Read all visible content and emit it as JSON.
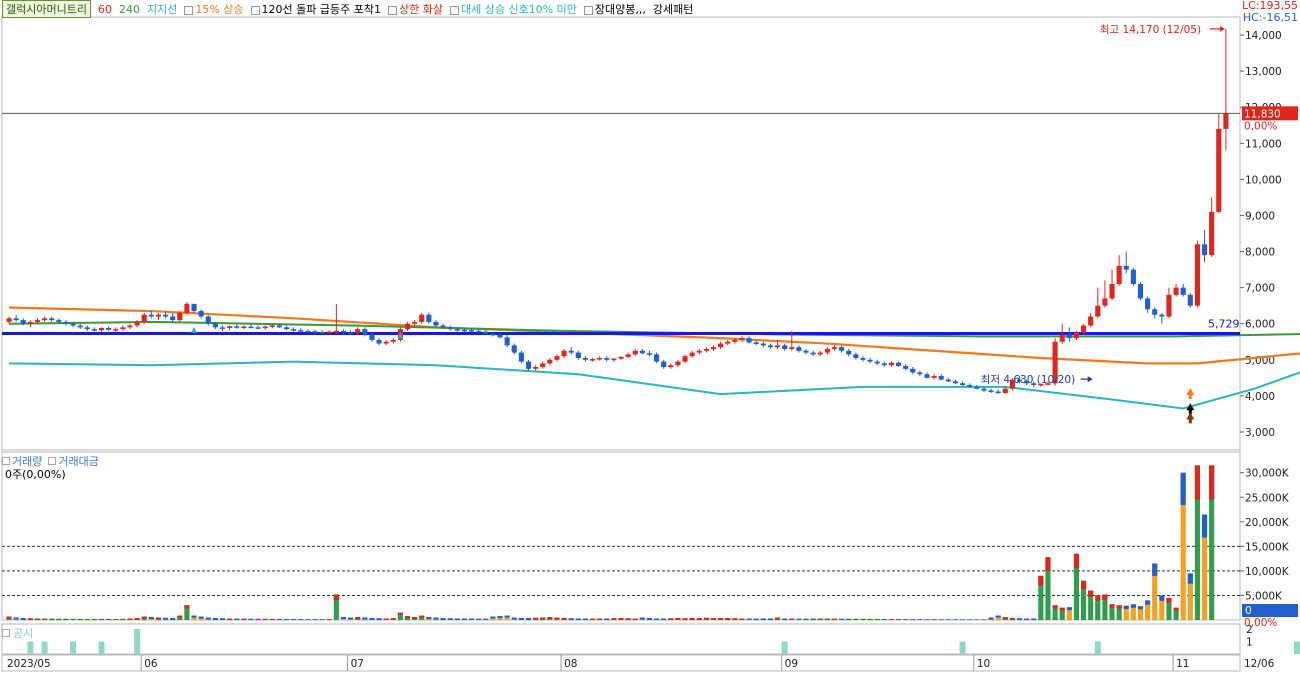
{
  "legend": {
    "title": "갤럭시아머니트리",
    "ma60": "60",
    "ma240": "240",
    "support": "지지선",
    "rise15": "15% 상승",
    "breakout": "120선 돌파 급등주 포착1",
    "limit_up": "상한 화살",
    "trend": "대세 상승 신호10% 미만",
    "long_candle": "장대양봉,,,",
    "strong": "강세패턴"
  },
  "top_right": {
    "lc": "LC:193,55",
    "hc": "HC:-16,51"
  },
  "annotations": {
    "high": "최고 14,170 (12/05)",
    "low": "최저 4,630 (10/20)",
    "level_label": "5,729"
  },
  "price_tags": {
    "current": "11,830",
    "pct": "0,00%"
  },
  "volume_legend": {
    "a": "거래량",
    "b": "거래대금",
    "sub": "0주(0,00%)"
  },
  "volume_tags": {
    "current": "0",
    "pct": "0,00%"
  },
  "disclosure_legend": "공시",
  "colors": {
    "up": "#e0251b",
    "down": "#1f5fd0",
    "ma_green": "#3a9a3a",
    "ma_orange": "#f07a20",
    "ma_teal": "#2bb5c0",
    "support": "#1a1acf",
    "vol_green": "#2e9e4c",
    "vol_orange": "#f5a020"
  },
  "chart_data": {
    "type": "candlestick",
    "price_axis": {
      "ticks": [
        3000,
        4000,
        5000,
        6000,
        7000,
        8000,
        9000,
        10000,
        11000,
        12000,
        13000,
        14000
      ],
      "tick_labels": [
        "3,000",
        "4,000",
        "5,000",
        "6,000",
        "7,000",
        "8,000",
        "9,000",
        "10,000",
        "11,000",
        "12,000",
        "13,000",
        "14,000"
      ],
      "range": [
        2500,
        14500
      ]
    },
    "volume_axis": {
      "ticks": [
        5000,
        10000,
        15000,
        20000,
        25000,
        30000
      ],
      "tick_labels": [
        "5,000K",
        "10,000K",
        "15,000K",
        "20,000K",
        "25,000K",
        "30,000K"
      ],
      "range": [
        0,
        33000
      ]
    },
    "disclosure_axis": {
      "ticks": [
        1,
        2
      ],
      "tick_labels": [
        "1",
        "2"
      ]
    },
    "x_labels": [
      {
        "label": "2023/05",
        "bar": 0
      },
      {
        "label": "06",
        "bar": 19
      },
      {
        "label": "07",
        "bar": 48
      },
      {
        "label": "08",
        "bar": 78
      },
      {
        "label": "09",
        "bar": 109
      },
      {
        "label": "10",
        "bar": 136
      },
      {
        "label": "11",
        "bar": 164
      },
      {
        "label": "12",
        "bar": 195
      },
      {
        "label": "12/06",
        "bar": 206
      }
    ],
    "support_level": 5729,
    "high": 14170,
    "low": 4630,
    "candles": [
      [
        6050,
        6200,
        6000,
        6150
      ],
      [
        6150,
        6250,
        6050,
        6100
      ],
      [
        6100,
        6150,
        5950,
        6000
      ],
      [
        6000,
        6100,
        5900,
        6050
      ],
      [
        6050,
        6150,
        5980,
        6100
      ],
      [
        6100,
        6200,
        6050,
        6150
      ],
      [
        6150,
        6200,
        6050,
        6100
      ],
      [
        6100,
        6150,
        6000,
        6050
      ],
      [
        6050,
        6100,
        5950,
        6000
      ],
      [
        6000,
        6050,
        5900,
        5950
      ],
      [
        5950,
        6000,
        5850,
        5900
      ],
      [
        5900,
        5950,
        5800,
        5850
      ],
      [
        5850,
        5900,
        5780,
        5820
      ],
      [
        5820,
        5900,
        5780,
        5880
      ],
      [
        5880,
        5920,
        5800,
        5830
      ],
      [
        5830,
        5900,
        5780,
        5850
      ],
      [
        5850,
        5950,
        5800,
        5900
      ],
      [
        5900,
        6000,
        5850,
        5950
      ],
      [
        5950,
        6100,
        5900,
        6050
      ],
      [
        6050,
        6300,
        6000,
        6250
      ],
      [
        6250,
        6350,
        6150,
        6200
      ],
      [
        6200,
        6300,
        6100,
        6250
      ],
      [
        6250,
        6350,
        6150,
        6200
      ],
      [
        6200,
        6300,
        6050,
        6100
      ],
      [
        6100,
        6350,
        6050,
        6300
      ],
      [
        6300,
        6600,
        6250,
        6550
      ],
      [
        6550,
        6550,
        6300,
        6350
      ],
      [
        6350,
        6400,
        6150,
        6200
      ],
      [
        6200,
        6250,
        5950,
        6000
      ],
      [
        6000,
        6050,
        5850,
        5900
      ],
      [
        5900,
        5950,
        5800,
        5880
      ],
      [
        5880,
        5950,
        5820,
        5930
      ],
      [
        5930,
        5980,
        5860,
        5900
      ],
      [
        5900,
        5950,
        5850,
        5920
      ],
      [
        5920,
        5980,
        5870,
        5900
      ],
      [
        5900,
        5950,
        5850,
        5880
      ],
      [
        5880,
        5950,
        5830,
        5920
      ],
      [
        5920,
        5980,
        5870,
        5950
      ],
      [
        5950,
        6000,
        5880,
        5900
      ],
      [
        5900,
        5950,
        5820,
        5850
      ],
      [
        5850,
        5900,
        5780,
        5820
      ],
      [
        5820,
        5870,
        5760,
        5800
      ],
      [
        5800,
        5850,
        5740,
        5790
      ],
      [
        5790,
        5840,
        5730,
        5770
      ],
      [
        5770,
        5830,
        5720,
        5760
      ],
      [
        5760,
        5820,
        5710,
        5780
      ],
      [
        5780,
        6550,
        5720,
        5800
      ],
      [
        5800,
        5850,
        5700,
        5760
      ],
      [
        5760,
        5820,
        5700,
        5750
      ],
      [
        5750,
        5900,
        5700,
        5850
      ],
      [
        5850,
        5900,
        5650,
        5700
      ],
      [
        5700,
        5750,
        5500,
        5550
      ],
      [
        5550,
        5600,
        5400,
        5450
      ],
      [
        5450,
        5550,
        5400,
        5500
      ],
      [
        5500,
        5600,
        5450,
        5550
      ],
      [
        5550,
        5900,
        5500,
        5850
      ],
      [
        5850,
        6050,
        5800,
        6000
      ],
      [
        6000,
        6100,
        5900,
        6050
      ],
      [
        6050,
        6300,
        6000,
        6250
      ],
      [
        6250,
        6300,
        6000,
        6050
      ],
      [
        6050,
        6100,
        5900,
        5950
      ],
      [
        5950,
        6000,
        5850,
        5900
      ],
      [
        5900,
        5950,
        5800,
        5850
      ],
      [
        5850,
        5900,
        5780,
        5830
      ],
      [
        5830,
        5880,
        5770,
        5820
      ],
      [
        5820,
        5870,
        5760,
        5800
      ],
      [
        5800,
        5850,
        5740,
        5780
      ],
      [
        5780,
        5820,
        5700,
        5720
      ],
      [
        5720,
        5780,
        5650,
        5700
      ],
      [
        5700,
        5750,
        5600,
        5620
      ],
      [
        5620,
        5680,
        5350,
        5400
      ],
      [
        5400,
        5450,
        5150,
        5200
      ],
      [
        5200,
        5250,
        4900,
        4950
      ],
      [
        4950,
        5000,
        4700,
        4750
      ],
      [
        4750,
        4850,
        4700,
        4800
      ],
      [
        4800,
        4950,
        4750,
        4900
      ],
      [
        4900,
        5050,
        4850,
        5000
      ],
      [
        5000,
        5150,
        4950,
        5100
      ],
      [
        5100,
        5300,
        5050,
        5250
      ],
      [
        5250,
        5350,
        5150,
        5200
      ],
      [
        5200,
        5250,
        5000,
        5050
      ],
      [
        5050,
        5100,
        4950,
        5000
      ],
      [
        5000,
        5050,
        4950,
        5020
      ],
      [
        5020,
        5100,
        4980,
        5050
      ],
      [
        5050,
        5100,
        4950,
        5000
      ],
      [
        5000,
        5050,
        4950,
        5030
      ],
      [
        5030,
        5100,
        5000,
        5080
      ],
      [
        5080,
        5200,
        5050,
        5150
      ],
      [
        5150,
        5300,
        5100,
        5250
      ],
      [
        5250,
        5300,
        5150,
        5180
      ],
      [
        5180,
        5250,
        5100,
        5150
      ],
      [
        5150,
        5200,
        4900,
        4950
      ],
      [
        4950,
        5000,
        4750,
        4800
      ],
      [
        4800,
        4900,
        4750,
        4850
      ],
      [
        4850,
        5000,
        4800,
        4950
      ],
      [
        4950,
        5150,
        4900,
        5100
      ],
      [
        5100,
        5250,
        5050,
        5200
      ],
      [
        5200,
        5300,
        5150,
        5250
      ],
      [
        5250,
        5350,
        5200,
        5300
      ],
      [
        5300,
        5400,
        5250,
        5350
      ],
      [
        5350,
        5500,
        5300,
        5450
      ],
      [
        5450,
        5550,
        5400,
        5500
      ],
      [
        5500,
        5600,
        5450,
        5550
      ],
      [
        5550,
        5650,
        5500,
        5600
      ],
      [
        5600,
        5650,
        5450,
        5480
      ],
      [
        5480,
        5550,
        5400,
        5450
      ],
      [
        5450,
        5500,
        5350,
        5400
      ],
      [
        5400,
        5450,
        5300,
        5350
      ],
      [
        5350,
        5550,
        5300,
        5400
      ],
      [
        5400,
        5450,
        5250,
        5300
      ],
      [
        5300,
        5800,
        5250,
        5350
      ],
      [
        5350,
        5400,
        5200,
        5250
      ],
      [
        5250,
        5300,
        5150,
        5200
      ],
      [
        5200,
        5250,
        5100,
        5150
      ],
      [
        5150,
        5250,
        5100,
        5200
      ],
      [
        5200,
        5350,
        5150,
        5300
      ],
      [
        5300,
        5400,
        5250,
        5350
      ],
      [
        5350,
        5400,
        5200,
        5250
      ],
      [
        5250,
        5300,
        5100,
        5150
      ],
      [
        5150,
        5200,
        5000,
        5050
      ],
      [
        5050,
        5100,
        4950,
        5000
      ],
      [
        5000,
        5050,
        4900,
        4950
      ],
      [
        4950,
        5000,
        4850,
        4900
      ],
      [
        4900,
        4950,
        4800,
        4850
      ],
      [
        4850,
        4950,
        4800,
        4920
      ],
      [
        4920,
        4950,
        4800,
        4830
      ],
      [
        4830,
        4880,
        4700,
        4750
      ],
      [
        4750,
        4800,
        4600,
        4650
      ],
      [
        4650,
        4700,
        4550,
        4600
      ],
      [
        4600,
        4650,
        4480,
        4500
      ],
      [
        4500,
        4600,
        4450,
        4550
      ],
      [
        4550,
        4600,
        4430,
        4450
      ],
      [
        4450,
        4500,
        4380,
        4400
      ],
      [
        4400,
        4450,
        4320,
        4350
      ],
      [
        4350,
        4400,
        4280,
        4300
      ],
      [
        4300,
        4350,
        4220,
        4250
      ],
      [
        4250,
        4300,
        4180,
        4200
      ],
      [
        4200,
        4250,
        4100,
        4150
      ],
      [
        4150,
        4200,
        4080,
        4120
      ],
      [
        4120,
        4180,
        4050,
        4080
      ],
      [
        4080,
        4250,
        4060,
        4200
      ],
      [
        4200,
        4500,
        4150,
        4450
      ],
      [
        4450,
        4550,
        4350,
        4400
      ],
      [
        4400,
        4450,
        4300,
        4350
      ],
      [
        4350,
        4400,
        4250,
        4300
      ],
      [
        4300,
        4350,
        4250,
        4330
      ],
      [
        4330,
        4400,
        4280,
        4350
      ],
      [
        4350,
        5600,
        4280,
        5500
      ],
      [
        5500,
        6000,
        5450,
        5700
      ],
      [
        5700,
        5900,
        5500,
        5600
      ],
      [
        5600,
        5800,
        5550,
        5750
      ],
      [
        5750,
        6000,
        5700,
        5950
      ],
      [
        5950,
        6300,
        5900,
        6200
      ],
      [
        6200,
        7000,
        6150,
        6500
      ],
      [
        6500,
        7200,
        6450,
        6700
      ],
      [
        6700,
        7500,
        6650,
        7100
      ],
      [
        7100,
        7900,
        7050,
        7600
      ],
      [
        7600,
        8000,
        7400,
        7500
      ],
      [
        7500,
        7550,
        7050,
        7100
      ],
      [
        7100,
        7150,
        6650,
        6700
      ],
      [
        6700,
        6750,
        6300,
        6400
      ],
      [
        6400,
        6450,
        6150,
        6250
      ],
      [
        6250,
        6300,
        6000,
        6200
      ],
      [
        6200,
        7000,
        6150,
        6800
      ],
      [
        6800,
        7100,
        6750,
        7000
      ],
      [
        7000,
        7100,
        6750,
        6800
      ],
      [
        6800,
        6850,
        6450,
        6500
      ],
      [
        6500,
        8300,
        6450,
        8200
      ],
      [
        8200,
        8600,
        7700,
        7900
      ],
      [
        7900,
        9500,
        7850,
        9100
      ],
      [
        9100,
        11800,
        9050,
        11400
      ],
      [
        11400,
        14170,
        10800,
        11830
      ]
    ],
    "volume_k": [
      700,
      500,
      400,
      350,
      300,
      280,
      260,
      240,
      230,
      220,
      210,
      200,
      200,
      220,
      210,
      200,
      230,
      300,
      400,
      700,
      600,
      500,
      450,
      400,
      900,
      3000,
      900,
      700,
      500,
      400,
      350,
      300,
      280,
      260,
      250,
      240,
      230,
      220,
      210,
      200,
      190,
      180,
      170,
      170,
      160,
      170,
      5200,
      600,
      500,
      600,
      500,
      400,
      350,
      300,
      350,
      1500,
      800,
      600,
      900,
      600,
      500,
      400,
      350,
      300,
      300,
      280,
      260,
      250,
      700,
      800,
      900,
      500,
      400,
      400,
      450,
      500,
      600,
      500,
      400,
      350,
      300,
      300,
      280,
      280,
      300,
      350,
      400,
      350,
      300,
      500,
      400,
      300,
      300,
      350,
      400,
      350,
      400,
      400,
      450,
      400,
      400,
      400,
      350,
      300,
      300,
      280,
      320,
      300,
      500,
      300,
      280,
      260,
      260,
      280,
      300,
      280,
      260,
      250,
      240,
      230,
      220,
      210,
      210,
      200,
      200,
      180,
      170,
      170,
      160,
      160,
      150,
      150,
      140,
      140,
      130,
      130,
      130,
      130,
      500,
      900,
      600,
      400,
      350,
      300,
      300,
      9000,
      12800,
      3000,
      2500,
      2600,
      13500,
      8000,
      6000,
      5000,
      5200,
      3200,
      3000,
      2900,
      3200,
      2800,
      4000,
      11500,
      5000,
      4500,
      2500,
      30000,
      9500,
      31500,
      21500,
      31500
    ],
    "ma_green": [
      [
        0,
        6000
      ],
      [
        20,
        6050
      ],
      [
        48,
        5950
      ],
      [
        78,
        5800
      ],
      [
        109,
        5700
      ],
      [
        136,
        5650
      ],
      [
        164,
        5650
      ],
      [
        178,
        5700
      ],
      [
        194,
        5750
      ],
      [
        205,
        5850
      ],
      [
        210,
        5900
      ]
    ],
    "ma_orange": [
      [
        0,
        6450
      ],
      [
        20,
        6350
      ],
      [
        40,
        6150
      ],
      [
        60,
        5900
      ],
      [
        80,
        5750
      ],
      [
        100,
        5600
      ],
      [
        115,
        5450
      ],
      [
        130,
        5250
      ],
      [
        145,
        5050
      ],
      [
        160,
        4900
      ],
      [
        167,
        4900
      ],
      [
        180,
        5150
      ],
      [
        195,
        5400
      ],
      [
        210,
        5800
      ]
    ],
    "ma_teal": [
      [
        0,
        4900
      ],
      [
        20,
        4850
      ],
      [
        40,
        4950
      ],
      [
        60,
        4850
      ],
      [
        80,
        4600
      ],
      [
        100,
        4050
      ],
      [
        120,
        4250
      ],
      [
        140,
        4250
      ],
      [
        155,
        3900
      ],
      [
        165,
        3650
      ],
      [
        175,
        4200
      ],
      [
        185,
        4900
      ],
      [
        195,
        5400
      ],
      [
        206,
        6100
      ],
      [
        210,
        6350
      ]
    ],
    "disclosure": [
      {
        "bar": 3,
        "v": 1
      },
      {
        "bar": 5,
        "v": 1
      },
      {
        "bar": 9,
        "v": 1
      },
      {
        "bar": 13,
        "v": 1
      },
      {
        "bar": 18,
        "v": 2
      },
      {
        "bar": 109,
        "v": 1
      },
      {
        "bar": 134,
        "v": 1
      },
      {
        "bar": 153,
        "v": 1
      },
      {
        "bar": 181,
        "v": 1
      },
      {
        "bar": 193,
        "v": 1
      },
      {
        "bar": 196,
        "v": 1
      },
      {
        "bar": 211,
        "v": 1
      },
      {
        "bar": 214,
        "v": 2
      }
    ]
  }
}
